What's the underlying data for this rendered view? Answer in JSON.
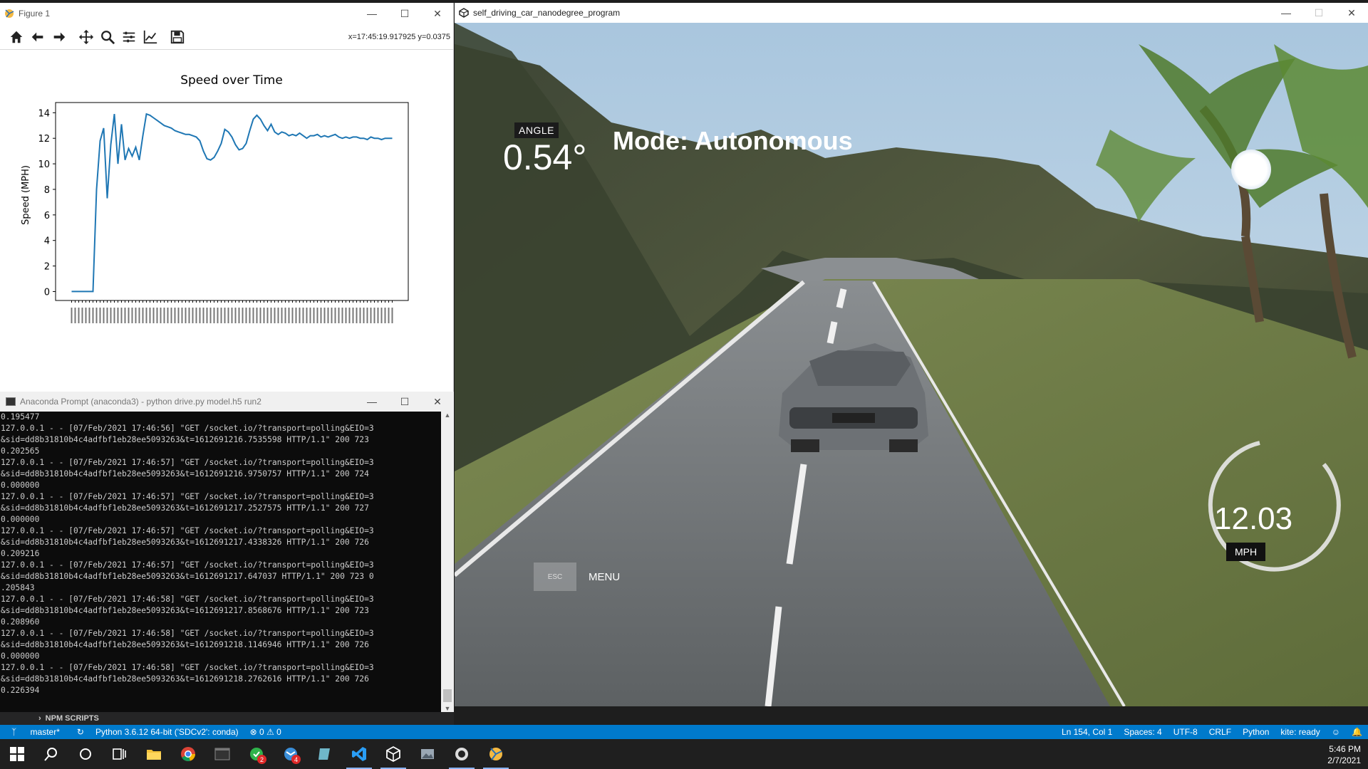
{
  "figure_window": {
    "title": "Figure 1",
    "coord_readout": "x=17:45:19.917925 y=0.0375",
    "toolbar": [
      "home-icon",
      "back-icon",
      "forward-icon",
      "pan-icon",
      "zoom-icon",
      "subplots-icon",
      "edit-axis-icon",
      "save-icon"
    ]
  },
  "chart_data": {
    "type": "line",
    "title": "Speed over Time",
    "xlabel": "",
    "ylabel": "Speed (MPH)",
    "ylim": [
      -0.7,
      14.8
    ],
    "yticks": [
      0,
      2,
      4,
      6,
      8,
      10,
      12,
      14
    ],
    "grid": false,
    "color": "#1f77b4",
    "x": [
      0,
      1,
      2,
      3,
      4,
      5,
      6,
      7,
      8,
      9,
      10,
      11,
      12,
      13,
      14,
      15,
      16,
      17,
      18,
      19,
      20,
      21,
      22,
      23,
      24,
      25,
      26,
      27,
      28,
      29,
      30,
      31,
      32,
      33,
      34,
      35,
      36,
      37,
      38,
      39,
      40,
      41,
      42,
      43,
      44,
      45,
      46,
      47,
      48,
      49,
      50,
      51,
      52,
      53,
      54,
      55,
      56,
      57,
      58,
      59,
      60,
      61,
      62,
      63,
      64,
      65,
      66,
      67,
      68,
      69,
      70,
      71,
      72,
      73,
      74,
      75,
      76,
      77,
      78,
      79,
      80,
      81,
      82,
      83,
      84,
      85,
      86,
      87,
      88,
      89,
      90
    ],
    "values": [
      0.0,
      0.0,
      0.0,
      0.0,
      0.0,
      0.0,
      0.0,
      8.0,
      11.8,
      12.8,
      7.3,
      11.5,
      13.9,
      10.0,
      13.1,
      10.3,
      11.2,
      10.6,
      11.3,
      10.3,
      12.2,
      13.9,
      13.8,
      13.6,
      13.4,
      13.2,
      13.0,
      12.9,
      12.8,
      12.6,
      12.5,
      12.4,
      12.3,
      12.3,
      12.2,
      12.1,
      11.8,
      11.0,
      10.4,
      10.3,
      10.5,
      11.0,
      11.6,
      12.7,
      12.5,
      12.1,
      11.5,
      11.1,
      11.2,
      11.6,
      12.6,
      13.5,
      13.8,
      13.5,
      13.0,
      12.6,
      13.1,
      12.5,
      12.3,
      12.5,
      12.4,
      12.2,
      12.3,
      12.2,
      12.4,
      12.2,
      12.0,
      12.2,
      12.2,
      12.3,
      12.1,
      12.2,
      12.1,
      12.2,
      12.3,
      12.1,
      12.0,
      12.1,
      12.0,
      12.1,
      12.1,
      12.0,
      12.0,
      11.9,
      12.1,
      12.0,
      12.0,
      11.9,
      12.0,
      12.0,
      12.0
    ]
  },
  "prompt_window": {
    "title": "Anaconda Prompt (anaconda3) - python  drive.py model.h5 run2",
    "lines": [
      "0.195477",
      "127.0.0.1 - - [07/Feb/2021 17:46:56] \"GET /socket.io/?transport=polling&EIO=3",
      "&sid=dd8b31810b4c4adfbf1eb28ee5093263&t=1612691216.7535598 HTTP/1.1\" 200 723",
      "0.202565",
      "127.0.0.1 - - [07/Feb/2021 17:46:57] \"GET /socket.io/?transport=polling&EIO=3",
      "&sid=dd8b31810b4c4adfbf1eb28ee5093263&t=1612691216.9750757 HTTP/1.1\" 200 724",
      "0.000000",
      "127.0.0.1 - - [07/Feb/2021 17:46:57] \"GET /socket.io/?transport=polling&EIO=3",
      "&sid=dd8b31810b4c4adfbf1eb28ee5093263&t=1612691217.2527575 HTTP/1.1\" 200 727",
      "0.000000",
      "127.0.0.1 - - [07/Feb/2021 17:46:57] \"GET /socket.io/?transport=polling&EIO=3",
      "&sid=dd8b31810b4c4adfbf1eb28ee5093263&t=1612691217.4338326 HTTP/1.1\" 200 726",
      "0.209216",
      "127.0.0.1 - - [07/Feb/2021 17:46:57] \"GET /socket.io/?transport=polling&EIO=3",
      "&sid=dd8b31810b4c4adfbf1eb28ee5093263&t=1612691217.647037 HTTP/1.1\" 200 723 0",
      ".205843",
      "127.0.0.1 - - [07/Feb/2021 17:46:58] \"GET /socket.io/?transport=polling&EIO=3",
      "&sid=dd8b31810b4c4adfbf1eb28ee5093263&t=1612691217.8568676 HTTP/1.1\" 200 723",
      "0.208960",
      "127.0.0.1 - - [07/Feb/2021 17:46:58] \"GET /socket.io/?transport=polling&EIO=3",
      "&sid=dd8b31810b4c4adfbf1eb28ee5093263&t=1612691218.1146946 HTTP/1.1\" 200 726",
      "0.000000",
      "127.0.0.1 - - [07/Feb/2021 17:46:58] \"GET /socket.io/?transport=polling&EIO=3",
      "&sid=dd8b31810b4c4adfbf1eb28ee5093263&t=1612691218.2762616 HTTP/1.1\" 200 726",
      "0.226394"
    ]
  },
  "sim_window": {
    "title": "self_driving_car_nanodegree_program",
    "angle_label": "ANGLE",
    "angle_value": "0.54°",
    "mode_text": "Mode: Autonomous",
    "speed_value": "12.03",
    "speed_unit": "MPH",
    "esc_label": "ESC",
    "menu_label": "MENU"
  },
  "npm_scripts": "NPM SCRIPTS",
  "statusbar": {
    "branch": "master*",
    "python": "Python 3.6.12 64-bit ('SDCv2': conda)",
    "problems": "⊗ 0 ⚠ 0",
    "position": "Ln 154, Col 1",
    "spaces": "Spaces: 4",
    "encoding": "UTF-8",
    "eol": "CRLF",
    "language": "Python",
    "kite": "kite: ready"
  },
  "taskbar": {
    "time": "5:46 PM",
    "date": "2/7/2021",
    "badge_green": "2",
    "badge_blue": "4"
  }
}
